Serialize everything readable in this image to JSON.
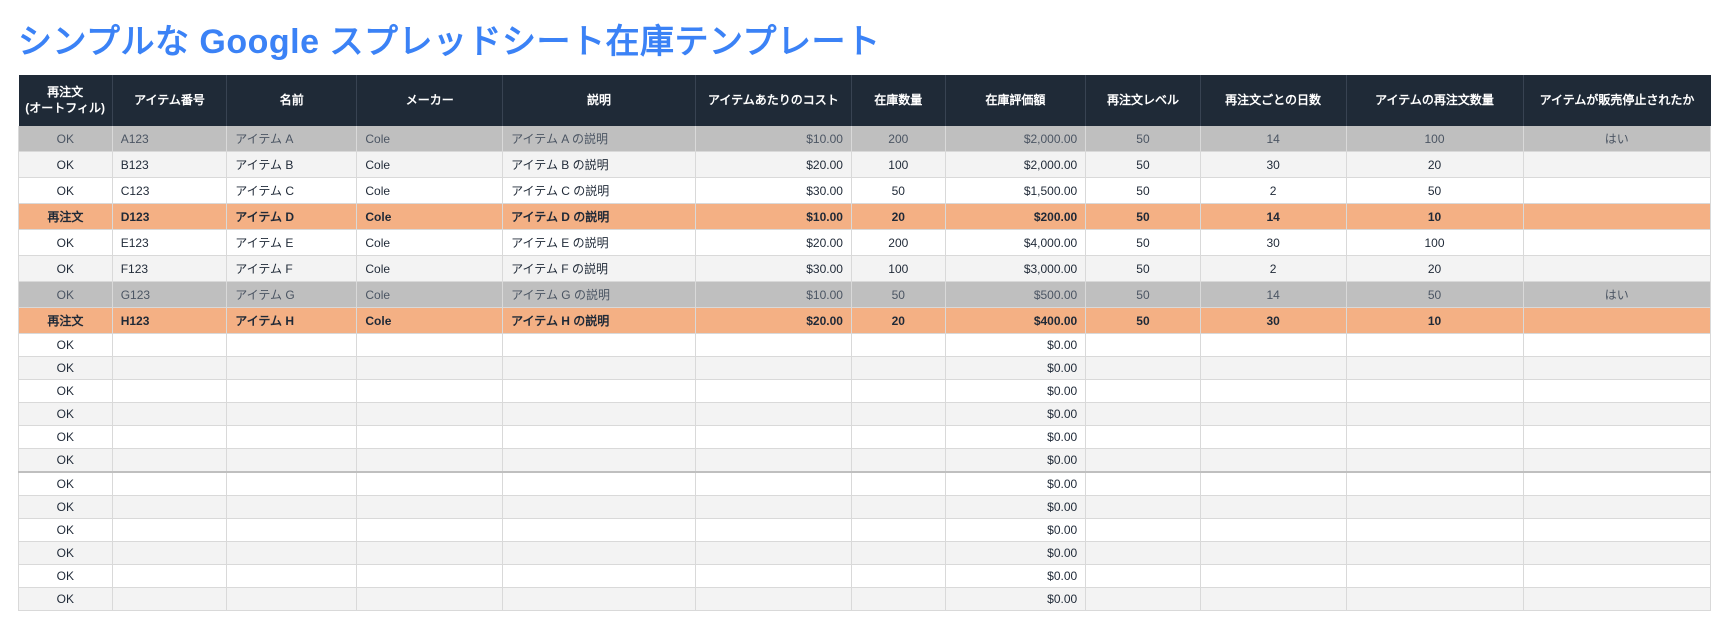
{
  "title": "シンプルな Google スプレッドシート在庫テンプレート",
  "headers": [
    "再注文\n(オートフィル)",
    "アイテム番号",
    "名前",
    "メーカー",
    "説明",
    "アイテムあたりのコスト",
    "在庫数量",
    "在庫評価額",
    "再注文レベル",
    "再注文ごとの日数",
    "アイテムの再注文数量",
    "アイテムが販売停止されたか"
  ],
  "rows": [
    {
      "style": "discontinued",
      "status": "OK",
      "item_no": "A123",
      "name": "アイテム A",
      "maker": "Cole",
      "desc": "アイテム A の説明",
      "cost": "$10.00",
      "qty": "200",
      "value": "$2,000.00",
      "reorder_lvl": "50",
      "days": "14",
      "reorder_qty": "100",
      "discontinued": "はい"
    },
    {
      "style": "alt",
      "status": "OK",
      "item_no": "B123",
      "name": "アイテム B",
      "maker": "Cole",
      "desc": "アイテム B の説明",
      "cost": "$20.00",
      "qty": "100",
      "value": "$2,000.00",
      "reorder_lvl": "50",
      "days": "30",
      "reorder_qty": "20",
      "discontinued": ""
    },
    {
      "style": "",
      "status": "OK",
      "item_no": "C123",
      "name": "アイテム C",
      "maker": "Cole",
      "desc": "アイテム C の説明",
      "cost": "$30.00",
      "qty": "50",
      "value": "$1,500.00",
      "reorder_lvl": "50",
      "days": "2",
      "reorder_qty": "50",
      "discontinued": ""
    },
    {
      "style": "reorder",
      "status": "再注文",
      "item_no": "D123",
      "name": "アイテム D",
      "maker": "Cole",
      "desc": "アイテム D の説明",
      "cost": "$10.00",
      "qty": "20",
      "value": "$200.00",
      "reorder_lvl": "50",
      "days": "14",
      "reorder_qty": "10",
      "discontinued": ""
    },
    {
      "style": "",
      "status": "OK",
      "item_no": "E123",
      "name": "アイテム E",
      "maker": "Cole",
      "desc": "アイテム E の説明",
      "cost": "$20.00",
      "qty": "200",
      "value": "$4,000.00",
      "reorder_lvl": "50",
      "days": "30",
      "reorder_qty": "100",
      "discontinued": ""
    },
    {
      "style": "alt",
      "status": "OK",
      "item_no": "F123",
      "name": "アイテム F",
      "maker": "Cole",
      "desc": "アイテム F の説明",
      "cost": "$30.00",
      "qty": "100",
      "value": "$3,000.00",
      "reorder_lvl": "50",
      "days": "2",
      "reorder_qty": "20",
      "discontinued": ""
    },
    {
      "style": "discontinued",
      "status": "OK",
      "item_no": "G123",
      "name": "アイテム G",
      "maker": "Cole",
      "desc": "アイテム G の説明",
      "cost": "$10.00",
      "qty": "50",
      "value": "$500.00",
      "reorder_lvl": "50",
      "days": "14",
      "reorder_qty": "50",
      "discontinued": "はい"
    },
    {
      "style": "reorder",
      "status": "再注文",
      "item_no": "H123",
      "name": "アイテム H",
      "maker": "Cole",
      "desc": "アイテム H の説明",
      "cost": "$20.00",
      "qty": "20",
      "value": "$400.00",
      "reorder_lvl": "50",
      "days": "30",
      "reorder_qty": "10",
      "discontinued": ""
    },
    {
      "style": "",
      "status": "OK",
      "item_no": "",
      "name": "",
      "maker": "",
      "desc": "",
      "cost": "",
      "qty": "",
      "value": "$0.00",
      "reorder_lvl": "",
      "days": "",
      "reorder_qty": "",
      "discontinued": ""
    },
    {
      "style": "alt",
      "status": "OK",
      "item_no": "",
      "name": "",
      "maker": "",
      "desc": "",
      "cost": "",
      "qty": "",
      "value": "$0.00",
      "reorder_lvl": "",
      "days": "",
      "reorder_qty": "",
      "discontinued": ""
    },
    {
      "style": "",
      "status": "OK",
      "item_no": "",
      "name": "",
      "maker": "",
      "desc": "",
      "cost": "",
      "qty": "",
      "value": "$0.00",
      "reorder_lvl": "",
      "days": "",
      "reorder_qty": "",
      "discontinued": ""
    },
    {
      "style": "alt",
      "status": "OK",
      "item_no": "",
      "name": "",
      "maker": "",
      "desc": "",
      "cost": "",
      "qty": "",
      "value": "$0.00",
      "reorder_lvl": "",
      "days": "",
      "reorder_qty": "",
      "discontinued": ""
    },
    {
      "style": "",
      "status": "OK",
      "item_no": "",
      "name": "",
      "maker": "",
      "desc": "",
      "cost": "",
      "qty": "",
      "value": "$0.00",
      "reorder_lvl": "",
      "days": "",
      "reorder_qty": "",
      "discontinued": ""
    },
    {
      "style": "alt",
      "status": "OK",
      "item_no": "",
      "name": "",
      "maker": "",
      "desc": "",
      "cost": "",
      "qty": "",
      "value": "$0.00",
      "reorder_lvl": "",
      "days": "",
      "reorder_qty": "",
      "discontinued": ""
    },
    {
      "style": "thick-top",
      "status": "OK",
      "item_no": "",
      "name": "",
      "maker": "",
      "desc": "",
      "cost": "",
      "qty": "",
      "value": "$0.00",
      "reorder_lvl": "",
      "days": "",
      "reorder_qty": "",
      "discontinued": ""
    },
    {
      "style": "alt",
      "status": "OK",
      "item_no": "",
      "name": "",
      "maker": "",
      "desc": "",
      "cost": "",
      "qty": "",
      "value": "$0.00",
      "reorder_lvl": "",
      "days": "",
      "reorder_qty": "",
      "discontinued": ""
    },
    {
      "style": "",
      "status": "OK",
      "item_no": "",
      "name": "",
      "maker": "",
      "desc": "",
      "cost": "",
      "qty": "",
      "value": "$0.00",
      "reorder_lvl": "",
      "days": "",
      "reorder_qty": "",
      "discontinued": ""
    },
    {
      "style": "alt",
      "status": "OK",
      "item_no": "",
      "name": "",
      "maker": "",
      "desc": "",
      "cost": "",
      "qty": "",
      "value": "$0.00",
      "reorder_lvl": "",
      "days": "",
      "reorder_qty": "",
      "discontinued": ""
    },
    {
      "style": "",
      "status": "OK",
      "item_no": "",
      "name": "",
      "maker": "",
      "desc": "",
      "cost": "",
      "qty": "",
      "value": "$0.00",
      "reorder_lvl": "",
      "days": "",
      "reorder_qty": "",
      "discontinued": ""
    },
    {
      "style": "alt",
      "status": "OK",
      "item_no": "",
      "name": "",
      "maker": "",
      "desc": "",
      "cost": "",
      "qty": "",
      "value": "$0.00",
      "reorder_lvl": "",
      "days": "",
      "reorder_qty": "",
      "discontinued": ""
    }
  ]
}
